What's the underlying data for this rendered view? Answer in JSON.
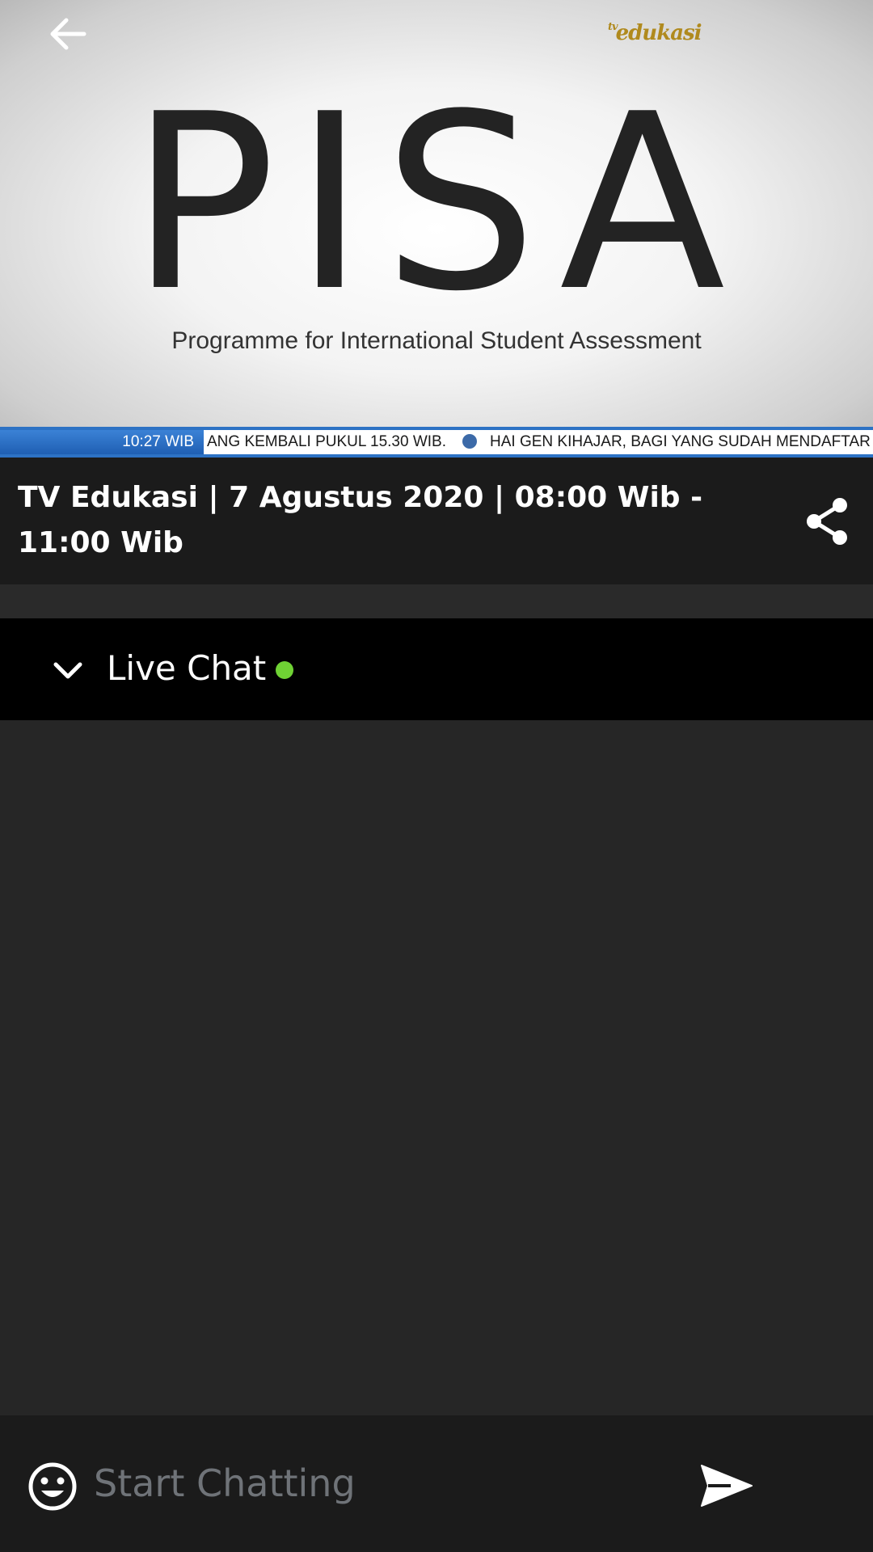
{
  "video": {
    "logo_text": "edukasi",
    "logo_prefix": "tv",
    "headline": "PISA",
    "subtitle": "Programme for International Student Assessment",
    "ticker_time": "10:27 WIB",
    "ticker_text_1": "ANG KEMBALI PUKUL 15.30 WIB.",
    "ticker_text_2": "HAI GEN KIHAJAR, BAGI YANG SUDAH MENDAFTAR K"
  },
  "stream": {
    "title": "TV Edukasi | 7 Agustus 2020 | 08:00 Wib - 11:00 Wib"
  },
  "chat": {
    "header_label": "Live Chat",
    "status_color": "#6fd234",
    "input_placeholder": "Start Chatting"
  },
  "icons": {
    "back": "arrow-left-icon",
    "share": "share-icon",
    "collapse": "chevron-down-icon",
    "emoji": "emoji-icon",
    "send": "send-icon"
  }
}
